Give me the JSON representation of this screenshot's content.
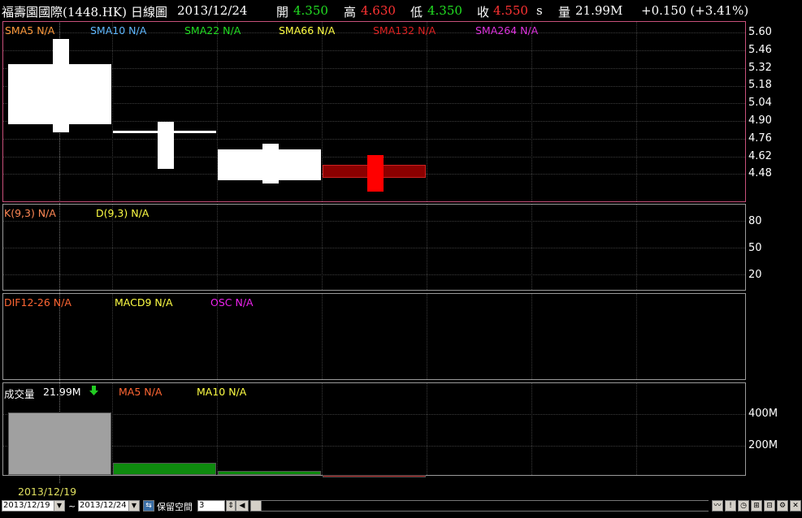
{
  "header": {
    "stock": "福壽園國際(1448.HK)",
    "chart_type": "日線圖",
    "date": "2013/12/24",
    "open_label": "開",
    "open": "4.350",
    "high_label": "高",
    "high": "4.630",
    "low_label": "低",
    "low": "4.350",
    "close_label": "收",
    "close": "4.550",
    "close_suffix": "s",
    "volume_label": "量",
    "volume": "21.99M",
    "change": "+0.150 (+3.41%)"
  },
  "price_panel": {
    "indicators": [
      {
        "label": "SMA5 N/A",
        "color": "#ff9a3c"
      },
      {
        "label": "SMA10 N/A",
        "color": "#5fb8ff"
      },
      {
        "label": "SMA22 N/A",
        "color": "#22dd22"
      },
      {
        "label": "SMA66 N/A",
        "color": "#ffff44"
      },
      {
        "label": "SMA132 N/A",
        "color": "#dd2222"
      },
      {
        "label": "SMA264 N/A",
        "color": "#dd33dd"
      }
    ],
    "y_ticks": [
      "5.60",
      "5.46",
      "5.32",
      "5.18",
      "5.04",
      "4.90",
      "4.76",
      "4.62",
      "4.48"
    ]
  },
  "candles": [
    {
      "open": 4.87,
      "high": 5.55,
      "low": 4.81,
      "close": 5.35,
      "color": "#ffffff"
    },
    {
      "open": 4.82,
      "high": 4.89,
      "low": 4.52,
      "close": 4.82,
      "color": "#ffffff"
    },
    {
      "open": 4.43,
      "high": 4.72,
      "low": 4.4,
      "close": 4.67,
      "color": "#ffffff"
    },
    {
      "open": 4.45,
      "high": 4.63,
      "low": 4.34,
      "close": 4.55,
      "color": "#8b0000"
    }
  ],
  "kd_panel": {
    "indicators": [
      {
        "label": "K(9,3) N/A",
        "color": "#ff8855"
      },
      {
        "label": "D(9,3) N/A",
        "color": "#ffff44"
      }
    ],
    "y_ticks": [
      "80",
      "50",
      "20"
    ]
  },
  "macd_panel": {
    "indicators": [
      {
        "label": "DIF12-26 N/A",
        "color": "#ff6633"
      },
      {
        "label": "MACD9 N/A",
        "color": "#ffff44"
      },
      {
        "label": "OSC N/A",
        "color": "#ee22ee"
      }
    ]
  },
  "volume_panel": {
    "label": "成交量",
    "value": "21.99M",
    "arrow": "down-arrow-icon",
    "indicators": [
      {
        "label": "MA5 N/A",
        "color": "#ff6633"
      },
      {
        "label": "MA10 N/A",
        "color": "#ffff44"
      }
    ],
    "y_ticks": [
      "400M",
      "200M"
    ]
  },
  "volume_bars": [
    {
      "value_m": 410,
      "color": "#a0a0a0"
    },
    {
      "value_m": 90,
      "color": "#0e8a0e"
    },
    {
      "value_m": 40,
      "color": "#0e8a0e"
    },
    {
      "value_m": 15,
      "color": "#9b1010"
    }
  ],
  "x_axis": {
    "date_label": "2013/12/19"
  },
  "toolbar": {
    "from_date": "2013/12/19",
    "tilde": "~",
    "to_date": "2013/12/24",
    "reserve_label": "保留空間",
    "reserve_value": "3"
  }
}
